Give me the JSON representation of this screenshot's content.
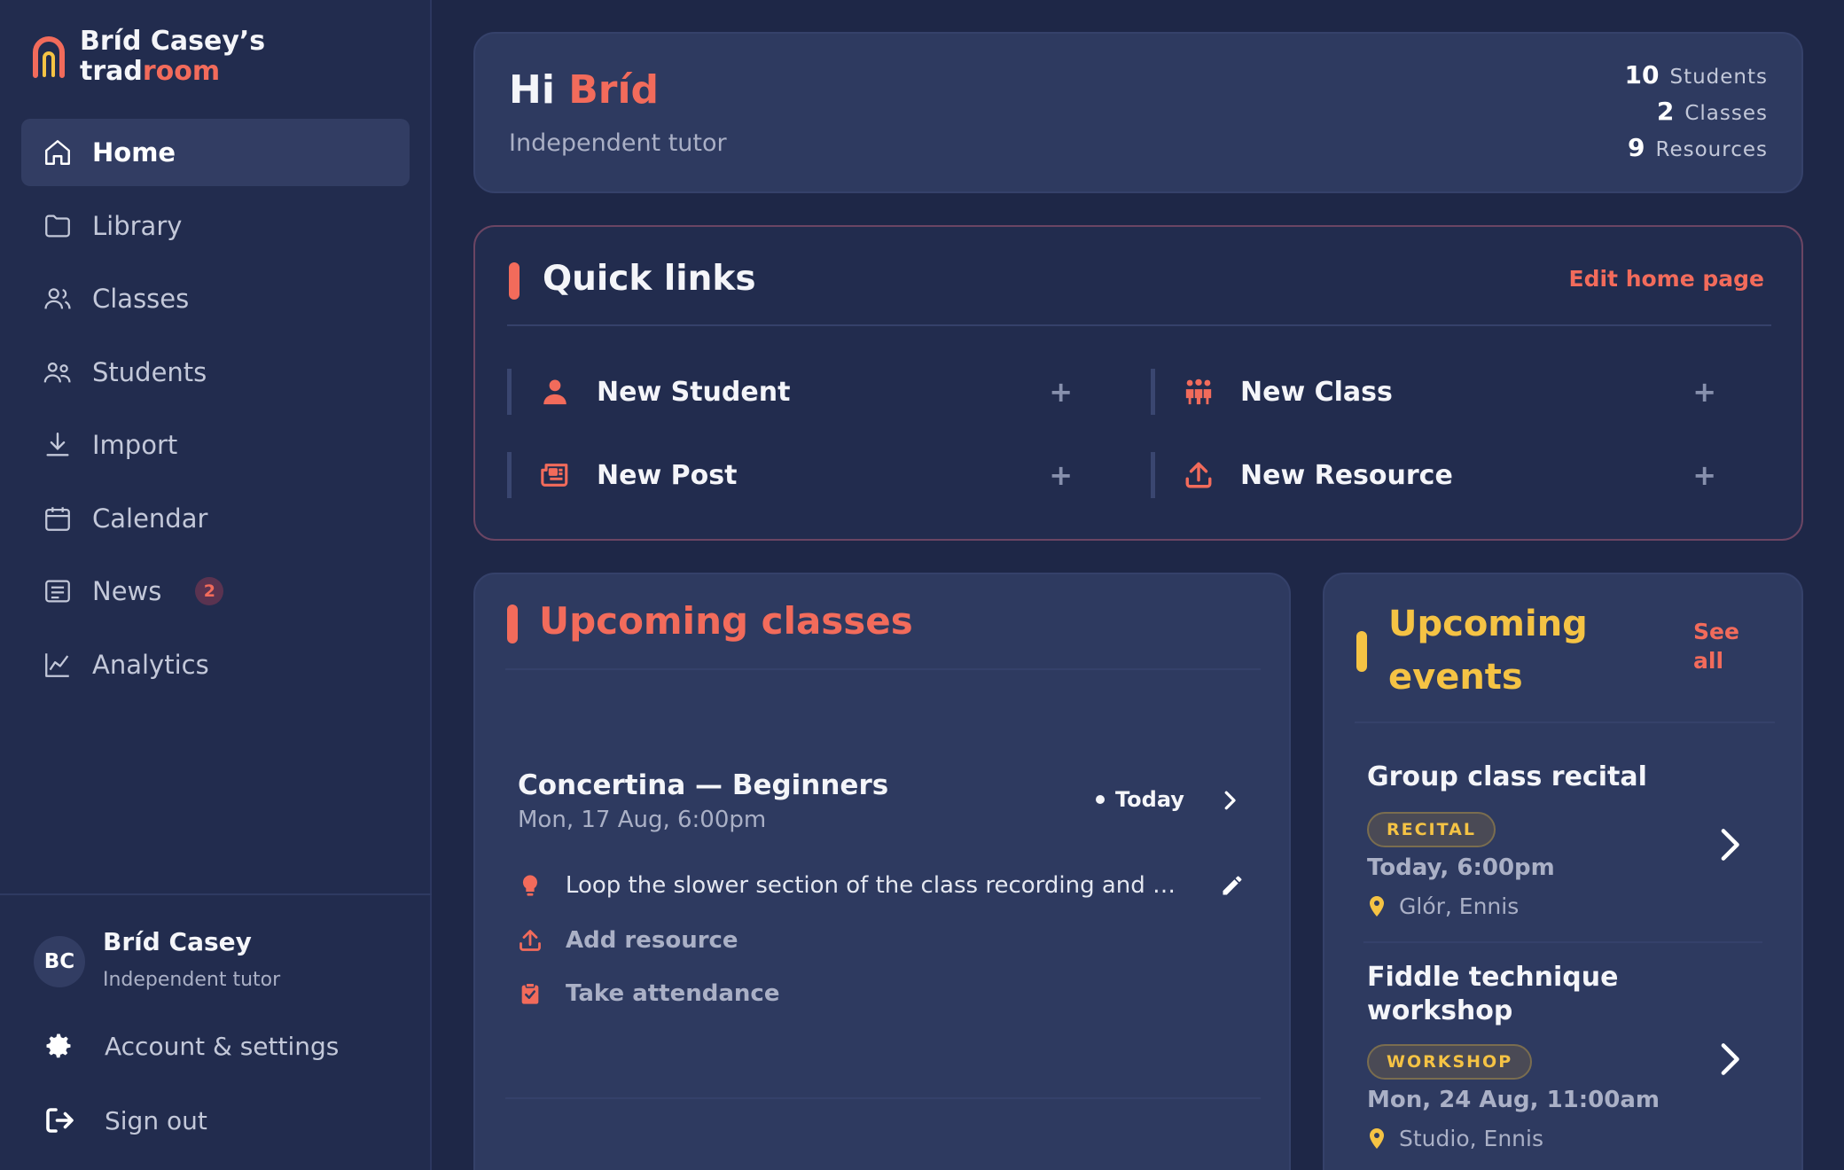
{
  "brand": {
    "line1": "Bríd Casey’s",
    "line2_a": "trad",
    "line2_b": "room"
  },
  "nav": [
    {
      "label": "Home",
      "icon": "home-icon",
      "active": true
    },
    {
      "label": "Library",
      "icon": "folder-icon"
    },
    {
      "label": "Classes",
      "icon": "users-icon"
    },
    {
      "label": "Students",
      "icon": "students-icon"
    },
    {
      "label": "Import",
      "icon": "download-icon"
    },
    {
      "label": "Calendar",
      "icon": "calendar-icon"
    },
    {
      "label": "News",
      "icon": "news-icon",
      "badge": "2"
    },
    {
      "label": "Analytics",
      "icon": "chart-icon"
    }
  ],
  "profile": {
    "initials": "BC",
    "name": "Bríd Casey",
    "role": "Independent tutor"
  },
  "account": {
    "settings": "Account & settings",
    "signout": "Sign out"
  },
  "hero": {
    "greeting": "Hi",
    "name": "Bríd",
    "subtitle": "Independent tutor",
    "stats": [
      {
        "num": "10",
        "label": "Students"
      },
      {
        "num": "2",
        "label": "Classes"
      },
      {
        "num": "9",
        "label": "Resources"
      }
    ]
  },
  "quick_links": {
    "title": "Quick links",
    "edit": "Edit home page",
    "items": [
      {
        "label": "New Student",
        "icon": "person-icon",
        "plus": "+"
      },
      {
        "label": "New Class",
        "icon": "group-icon",
        "plus": "+"
      },
      {
        "label": "New Post",
        "icon": "newspaper-icon",
        "plus": "+"
      },
      {
        "label": "New Resource",
        "icon": "upload-icon",
        "plus": "+"
      }
    ]
  },
  "upcoming_classes": {
    "title": "Upcoming classes",
    "item": {
      "name": "Concertina — Beginners",
      "time": "Mon, 17 Aug, 6:00pm",
      "status": "Today",
      "note": "Loop the slower section of the class recording and work through it bar by bar",
      "add_resource": "Add resource",
      "take_attendance": "Take attendance"
    }
  },
  "upcoming_events": {
    "title": "Upcoming events",
    "see_all": "See all",
    "items": [
      {
        "name": "Group class recital",
        "tag": "RECITAL",
        "when": "Today, 6:00pm",
        "where": "Glór, Ennis"
      },
      {
        "name": "Fiddle technique workshop",
        "tag": "WORKSHOP",
        "when": "Mon, 24 Aug, 11:00am",
        "where": "Studio, Ennis"
      }
    ]
  },
  "colors": {
    "accent": "#f26b5b",
    "events": "#f5c344",
    "background": "#1e2747",
    "card": "#2e3a60"
  }
}
